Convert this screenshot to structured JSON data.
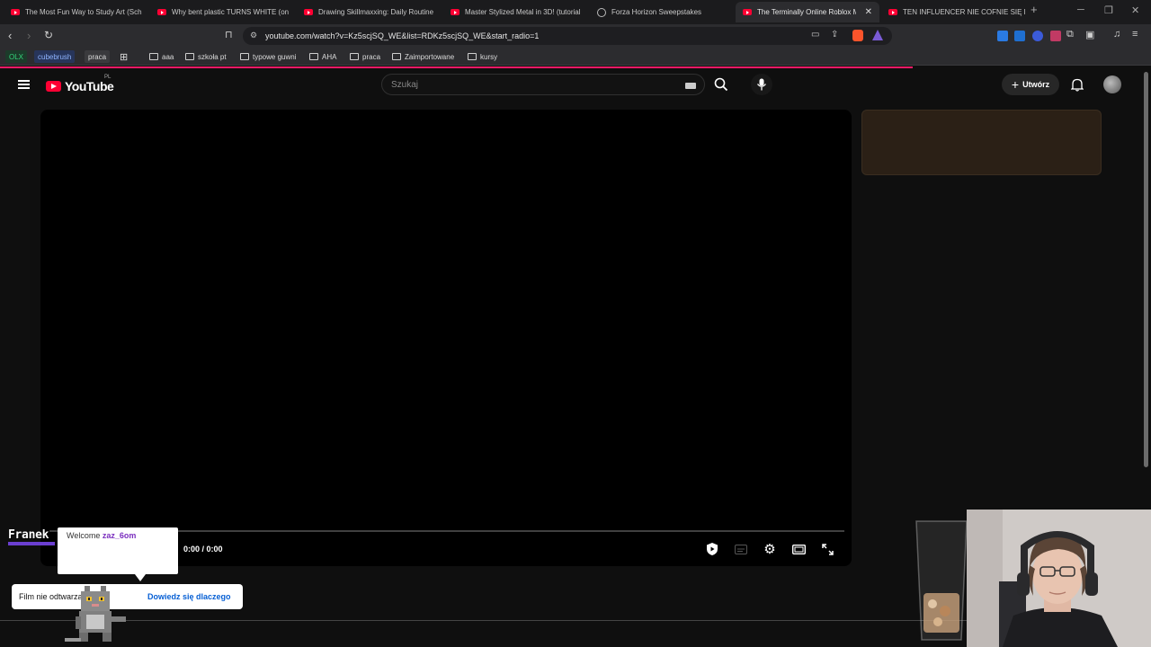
{
  "browser": {
    "tabs": [
      {
        "title": "The Most Fun Way to Study Art (Sch",
        "icon": "youtube-icon"
      },
      {
        "title": "Why bent plastic TURNS WHITE (on",
        "icon": "youtube-icon"
      },
      {
        "title": "Drawing Skillmaxxing: Daily Routine",
        "icon": "youtube-icon"
      },
      {
        "title": "Master Stylized Metal in 3D! (tutorial",
        "icon": "youtube-icon"
      },
      {
        "title": "Forza Horizon Sweepstakes",
        "icon": "globe-icon"
      },
      {
        "title": "The Terminally Online Roblox M",
        "icon": "youtube-icon",
        "active": true
      },
      {
        "title": "TEN INFLUENCER NIE COFNIE SIĘ PR",
        "icon": "youtube-icon"
      }
    ],
    "new_tab": "+",
    "url": "youtube.com/watch?v=Kz5scjSQ_WE&list=RDKz5scjSQ_WE&start_radio=1",
    "bookmarks": {
      "chips": [
        "OLX",
        "cubebrush",
        "praca"
      ],
      "folders": [
        "aaa",
        "szkoła pt",
        "typowe guwni",
        "AHA",
        "praca",
        "Zaimportowane",
        "kursy"
      ]
    },
    "colors": {
      "accent": "#ff1a67",
      "tab_bg": "#1b1b1d",
      "toolbar_bg": "#2c2c2f"
    }
  },
  "youtube": {
    "logo_text": "YouTube",
    "country_code": "PL",
    "search_placeholder": "Szukaj",
    "create_label": "Utwórz",
    "player": {
      "time": "0:00 / 0:00"
    }
  },
  "overlay": {
    "streamer_name": "Franek",
    "welcome_prefix": "Welcome ",
    "welcome_user": "zaz_6om",
    "notice_text": "Film nie odtwarza się?",
    "notice_link": "Dowiedz się dlaczego"
  }
}
